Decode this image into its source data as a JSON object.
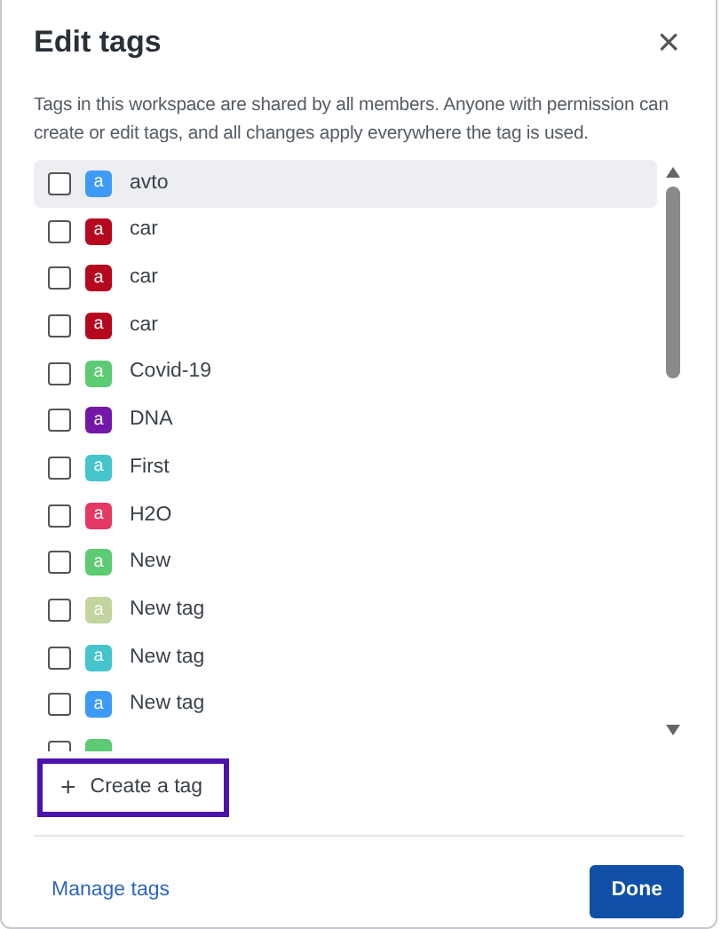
{
  "dialog": {
    "title": "Edit tags",
    "close": "×",
    "description": "Tags in this workspace are shared by all members. Anyone with permission can create or edit tags, and all changes apply everywhere the tag is used."
  },
  "tags": [
    {
      "label": "avto",
      "letter": "a",
      "color": "#3d9bf5",
      "checked": false,
      "selected": true
    },
    {
      "label": "car",
      "letter": "a",
      "color": "#b5081f",
      "checked": false,
      "selected": false
    },
    {
      "label": "car",
      "letter": "a",
      "color": "#b5081f",
      "checked": false,
      "selected": false
    },
    {
      "label": "car",
      "letter": "a",
      "color": "#b5081f",
      "checked": false,
      "selected": false
    },
    {
      "label": "Covid-19",
      "letter": "a",
      "color": "#5ccb73",
      "checked": false,
      "selected": false
    },
    {
      "label": "DNA",
      "letter": "a",
      "color": "#7318a6",
      "checked": false,
      "selected": false
    },
    {
      "label": "First",
      "letter": "a",
      "color": "#45c4cc",
      "checked": false,
      "selected": false
    },
    {
      "label": "H2O",
      "letter": "a",
      "color": "#e33962",
      "checked": false,
      "selected": false
    },
    {
      "label": "New",
      "letter": "a",
      "color": "#5ccb73",
      "checked": false,
      "selected": false
    },
    {
      "label": "New tag",
      "letter": "a",
      "color": "#c3d49e",
      "checked": false,
      "selected": false
    },
    {
      "label": "New tag",
      "letter": "a",
      "color": "#45c4cc",
      "checked": false,
      "selected": false
    },
    {
      "label": "New tag",
      "letter": "a",
      "color": "#3d9bf5",
      "checked": false,
      "selected": false
    },
    {
      "color": "#5ccb73",
      "checked": false,
      "selected": false
    }
  ],
  "create_button": {
    "icon": "+",
    "label": "Create a tag",
    "focused": true
  },
  "footer": {
    "link": "Manage tags",
    "button": "Done"
  }
}
